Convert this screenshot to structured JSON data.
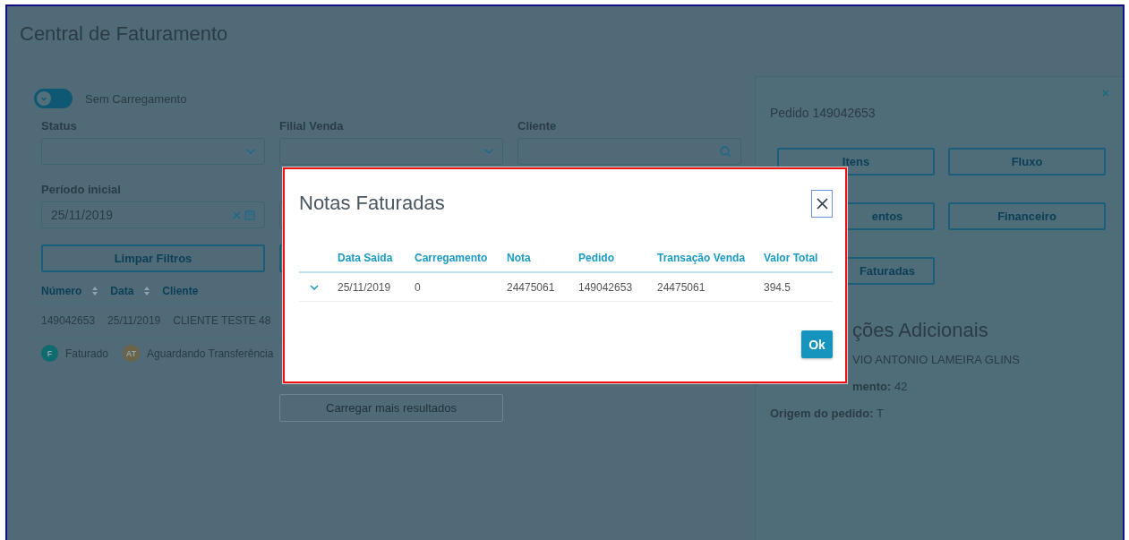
{
  "page_title": "Central de Faturamento",
  "filters": {
    "toggle": {
      "label": "Sem Carregamento",
      "on": false
    },
    "fields": [
      {
        "label": "Status",
        "kind": "select"
      },
      {
        "label": "Filial Venda",
        "kind": "select"
      },
      {
        "label": "Cliente",
        "kind": "search"
      }
    ],
    "period": {
      "label": "Período inicial",
      "value": "25/11/2019"
    },
    "clear_button": "Limpar Filtros"
  },
  "results": {
    "columns": [
      {
        "label": "Número",
        "sortable": true
      },
      {
        "label": "Data",
        "sortable": true
      },
      {
        "label": "Cliente",
        "sortable": false
      }
    ],
    "rows": [
      {
        "cells": [
          "149042653",
          "25/11/2019",
          "CLIENTE TESTE 48"
        ]
      }
    ],
    "legend": [
      {
        "code": "F",
        "label": "Faturado",
        "color": "#0e6b6e"
      },
      {
        "code": "AT",
        "label": "Aguardando Transferência",
        "color": "#6b6449"
      }
    ],
    "load_more": {
      "label": "Carregar mais resultados",
      "disabled": true
    }
  },
  "side_panel": {
    "title": "Pedido 149042653",
    "buttons": [
      "Itens",
      "Fluxo",
      "entos",
      "Financeiro",
      "Faturadas"
    ],
    "section_title": "ções Adicionais",
    "lines": [
      {
        "kind": "plain",
        "text": "VIO ANTONIO LAMEIRA GLINS"
      },
      {
        "kind": "pair",
        "label": "mento:",
        "value": "42"
      },
      {
        "kind": "pair",
        "label": "Origem do pedido:",
        "value": "T"
      }
    ]
  },
  "modal": {
    "title": "Notas Faturadas",
    "columns": [
      "Data Saida",
      "Carregamento",
      "Nota",
      "Pedido",
      "Transação Venda",
      "Valor Total"
    ],
    "rows": [
      {
        "expanded": false,
        "cells": [
          "25/11/2019",
          "0",
          "24475061",
          "149042653",
          "24475061",
          "394.5"
        ]
      }
    ],
    "ok_button": "Ok"
  }
}
